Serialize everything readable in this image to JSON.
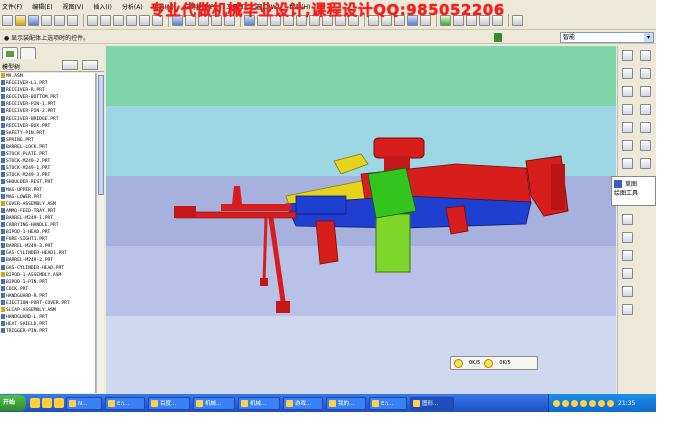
{
  "window": {
    "watermark": "专业代做机械毕业设计,课程设计QQ:985052206"
  },
  "menubar": {
    "items": [
      "文件(F)",
      "编辑(E)",
      "视图(V)",
      "插入(I)",
      "分析(A)",
      "信息(N)",
      "应用程序(P)",
      "工具(T)",
      "窗口(W)",
      "帮助(H)"
    ]
  },
  "message_line": {
    "text": "● 显示装配体上选项时的控件。"
  },
  "filter": {
    "value": "智能"
  },
  "model_tree": {
    "title": "模型树",
    "rows": [
      "M9.ASM",
      "RECEIVER-L1.PRT",
      "RECEIVER-R.PRT",
      "RECEIVER-BOTTOM.PRT",
      "RECEIVER-PIN-1.PRT",
      "RECEIVER-PIN-2.PRT",
      "RECEIVER-BRIDGE.PRT",
      "RECEIVER-BOX.PRT",
      "SAFETY-PIN.PRT",
      "SPRING.PRT",
      "BARREL-LOCK.PRT",
      "STOCK-PLATE.PRT",
      "STOCK-M249-2.PRT",
      "STOCK-M249-1.PRT",
      "STOCK-M249-3.PRT",
      "SHOULDER-REST.PRT",
      "MAG-UPPER.PRT",
      "MAG-LOWER.PRT",
      "COVER-ASSEMBLY.ASM",
      "AMMO-FEED-TRAY.PRT",
      "BARREL-M249-1.PRT",
      "CARRYING-HANDLE.PRT",
      "BIPOD-1-HEAD.PRT",
      "FORE-SIGHT1.PRT",
      "BARREL-M249-3.PRT",
      "GAS-CYLINDER-HEAD1.PRT",
      "BARREL-M249-2.PRT",
      "GAS-CYLINDER-HEAD.PRT",
      "BIPOD-1-ASSEMBLY.ASM",
      "BIPOD-1-PIN.PRT",
      "COCK.PRT",
      "HANDGUARD-R.PRT",
      "EJECTION-PORT-COVER.PRT",
      "SLCAP-ASSEMBLY.ASM",
      "HANDGUARD-L.PRT",
      "HEAT-SHIELD.PRT",
      "TRIGGER-PIN.PRT"
    ]
  },
  "tooltip": {
    "title": "草图",
    "subtitle": "绘图工具"
  },
  "mini_toolbar": {
    "label_1": "0K/5",
    "label_2": "0K/5"
  },
  "taskbar": {
    "start_label": "开始",
    "tasks": [
      "N...",
      "E:\\...",
      "百度...",
      "机械...",
      "机械...",
      "游戏...",
      "我的...",
      "E:\\...",
      "图形..."
    ],
    "clock": "21:35"
  },
  "colors": {
    "gun_red": "#d81d1d",
    "gun_yellow": "#e8d31c",
    "gun_blue": "#1e3fcf",
    "gun_green": "#33c41e",
    "mag_green": "#7fd62a"
  }
}
